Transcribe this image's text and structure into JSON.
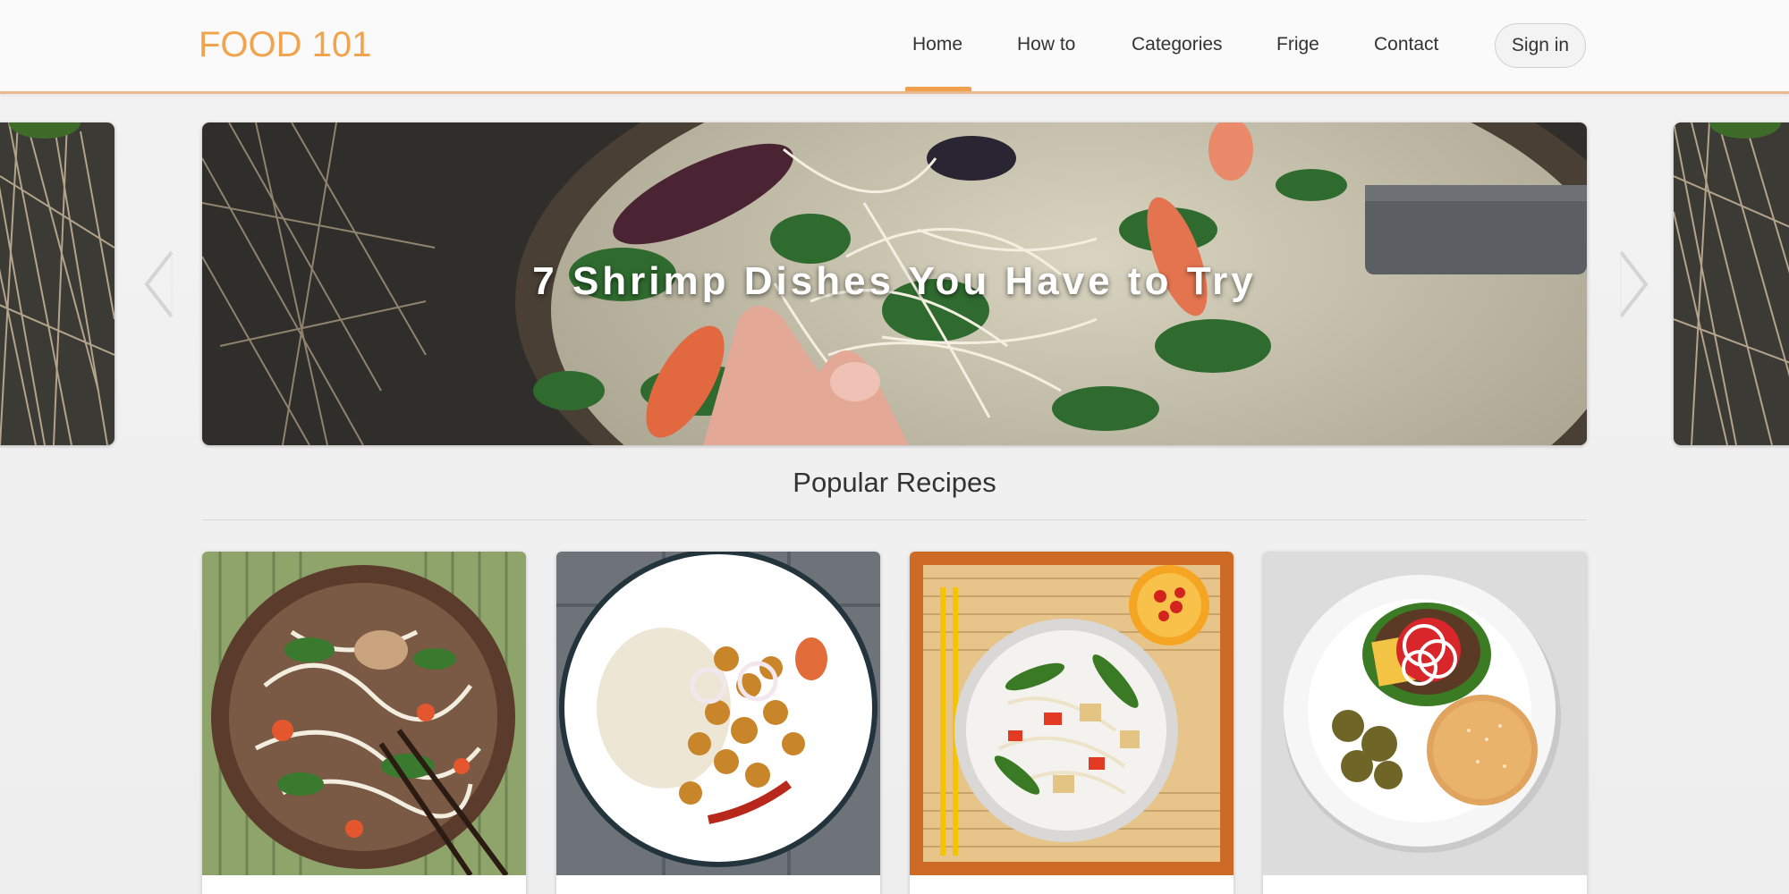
{
  "header": {
    "logo": "FOOD 101",
    "nav": [
      {
        "label": "Home",
        "active": true
      },
      {
        "label": "How to",
        "active": false
      },
      {
        "label": "Categories",
        "active": false
      },
      {
        "label": "Frige",
        "active": false
      },
      {
        "label": "Contact",
        "active": false
      }
    ],
    "sign_in": "Sign in"
  },
  "carousel": {
    "title": "7 Shrimp Dishes You Have to Try",
    "prev_icon": "chevron-left-icon",
    "next_icon": "chevron-right-icon"
  },
  "section": {
    "title": "Popular Recipes"
  },
  "colors": {
    "accent": "#f0a44e",
    "header_bg": "#fafafa",
    "page_bg": "#f0f0f0"
  }
}
